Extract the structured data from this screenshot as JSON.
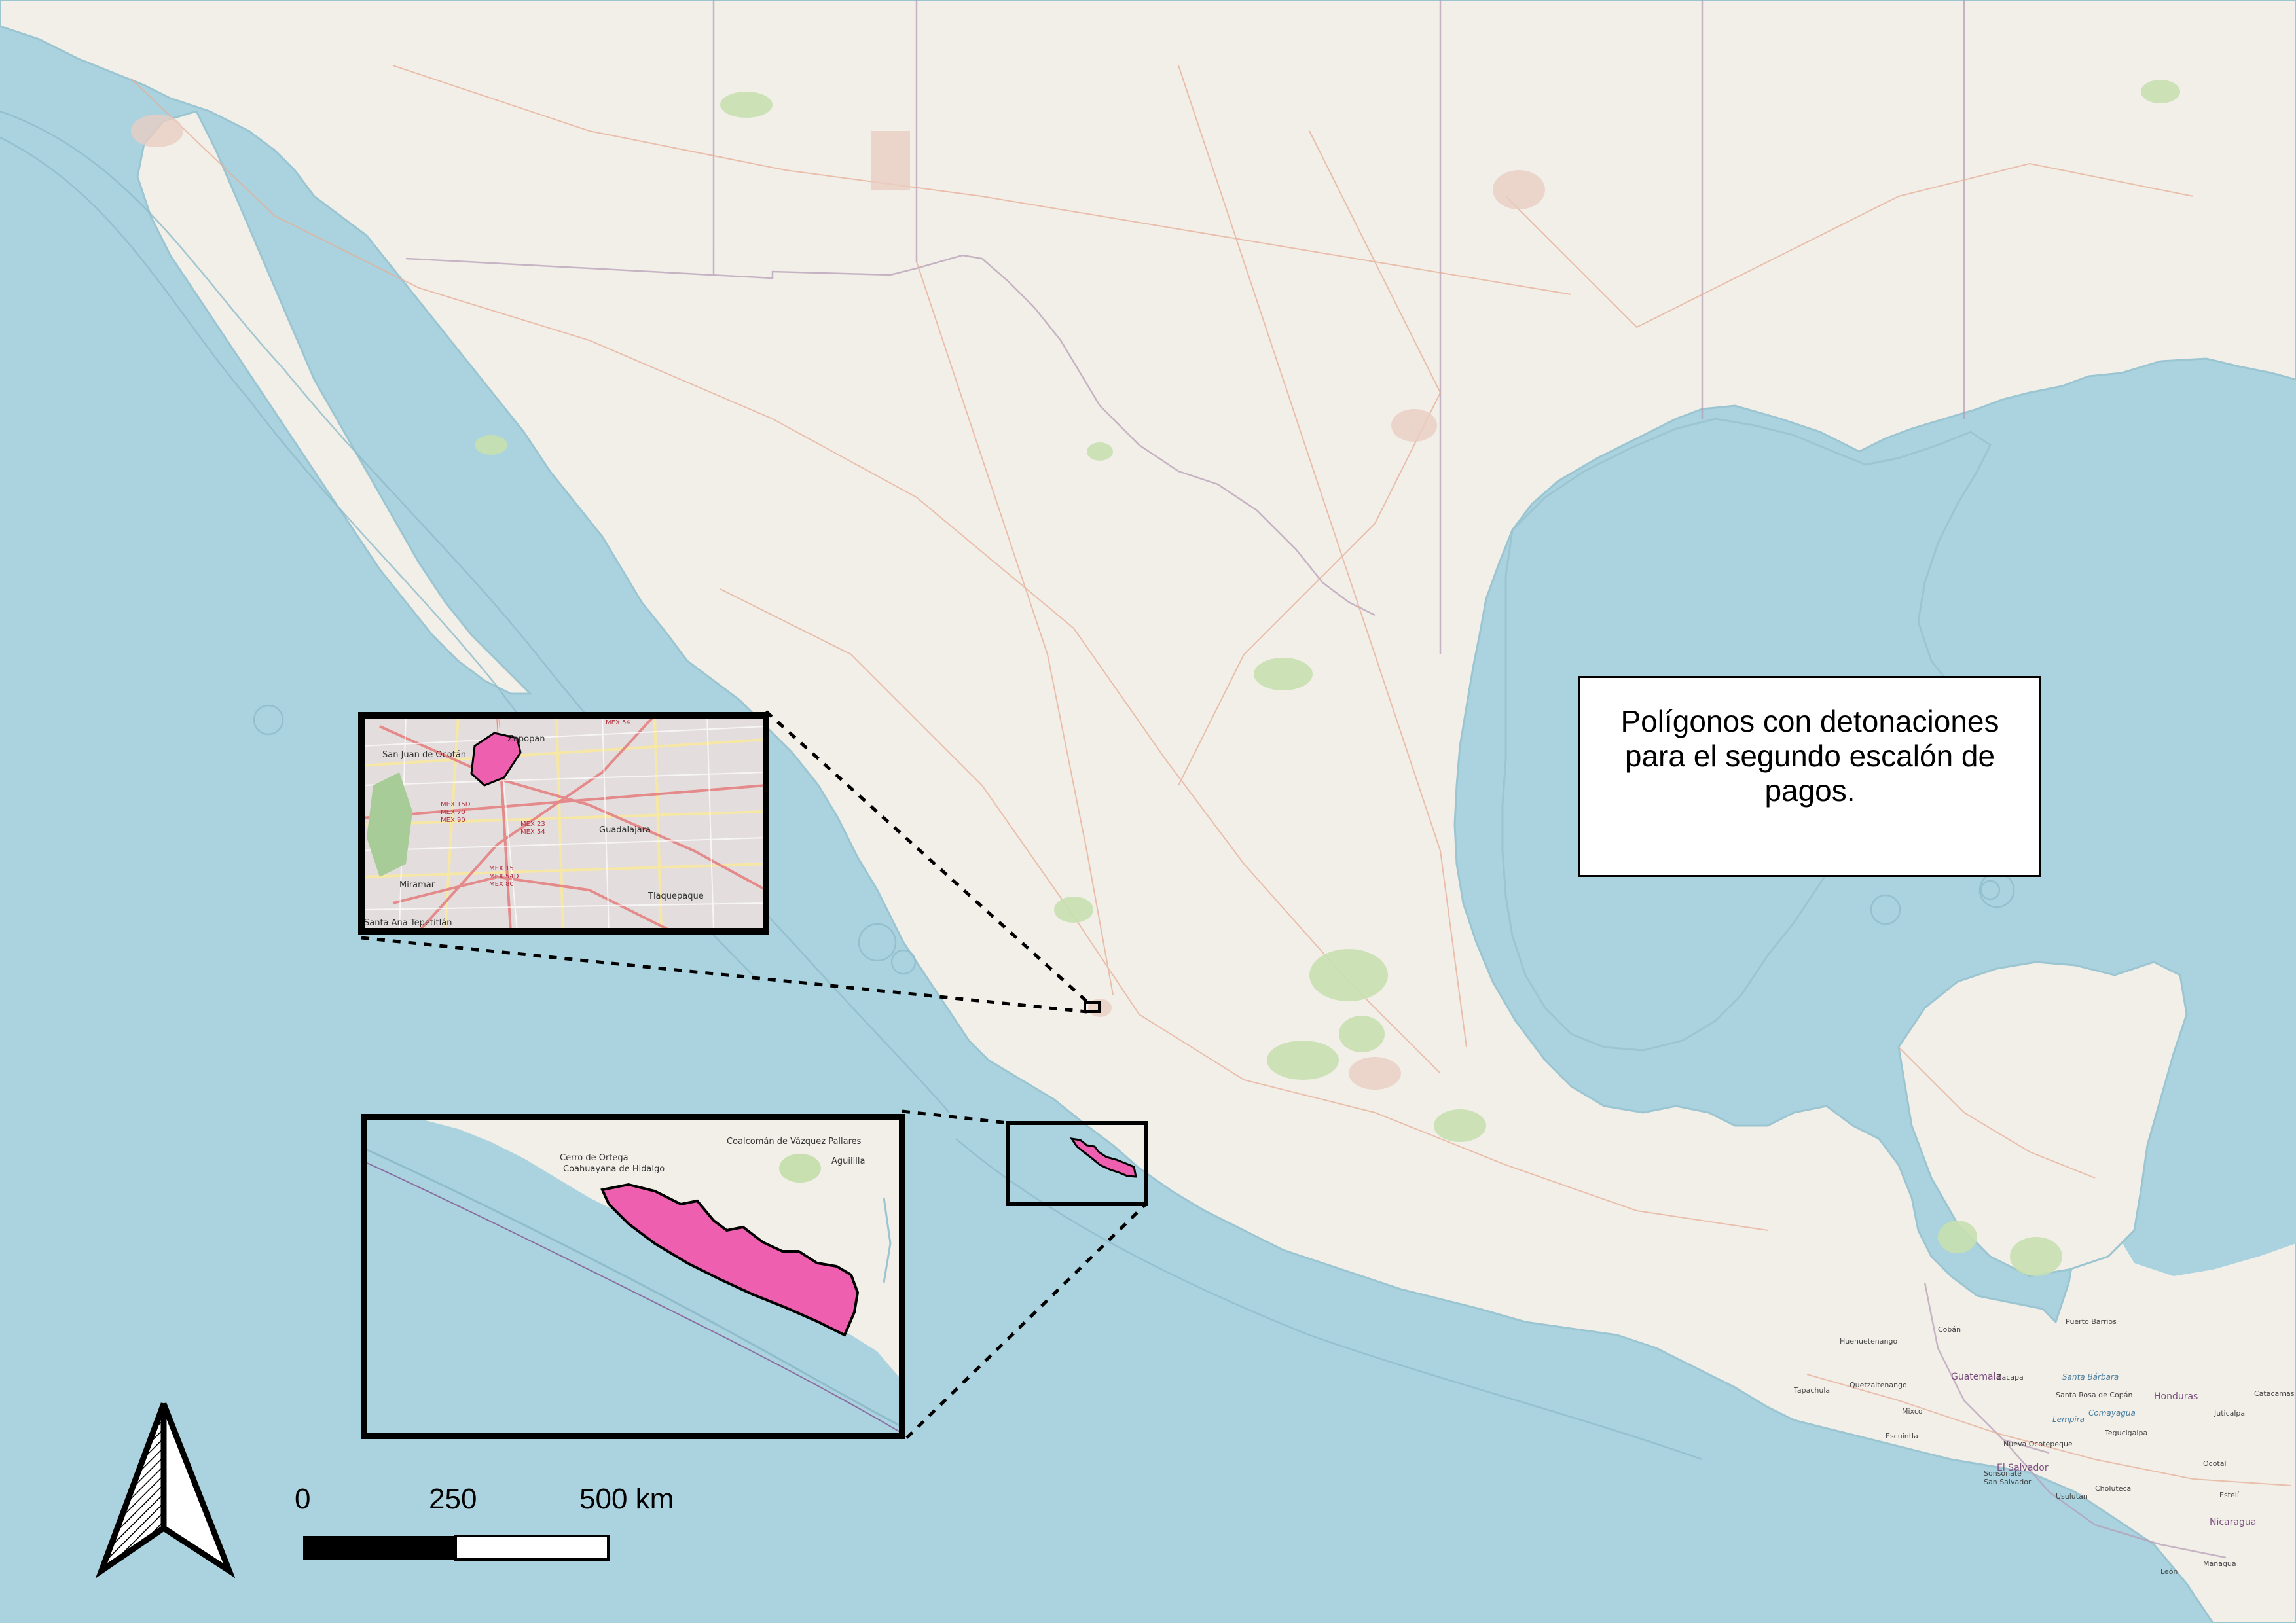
{
  "title": "Polígonos con detonaciones para el segundo escalón de pagos.",
  "scale_bar": {
    "labels": [
      "0",
      "250",
      "500 km"
    ]
  },
  "north_arrow": {
    "icon": "north-arrow-icon"
  },
  "colors": {
    "water": "#aad3df",
    "land": "#f2efe9",
    "polygon_fill": "#ee5fb0",
    "polygon_stroke": "#000000",
    "park": "#c8e0b0",
    "road": "#e8b9a0"
  },
  "inset_guadalajara": {
    "labels": [
      "Zapopan",
      "San Juan de Ocotán",
      "Guadalajara",
      "Tlaquepaque",
      "Miramar",
      "Santa Ana Tepetitlán"
    ],
    "road_labels": [
      "MEX 54",
      "MEX 15D",
      "MEX 70",
      "MEX 90",
      "MEX 23",
      "MEX 54",
      "MEX 15",
      "MEX 54D",
      "MEX 80"
    ]
  },
  "inset_coast": {
    "labels": [
      "Coalcomán de Vázquez Pallares",
      "Aguililla",
      "Cerro de Ortega",
      "Coahuayana de Hidalgo"
    ]
  },
  "map_labels": {
    "countries": [
      "Guatemala",
      "Honduras",
      "El Salvador",
      "Nicaragua"
    ],
    "cities": [
      "Huehuetenango",
      "Quetzaltenango",
      "Tapachula",
      "Escuintla",
      "Zacapa",
      "Santa Rosa de Copán",
      "Tegucigalpa",
      "Juticalpa",
      "Catacamas",
      "Puerto Barrios",
      "San Salvador",
      "Managua",
      "León",
      "Ocotal",
      "Estelí",
      "Sonsonate",
      "Usulután",
      "Choluteca",
      "Cobán",
      "Mixco",
      "Nueva Ocotepeque"
    ],
    "water": [
      "Santa Bárbara",
      "Comayagua",
      "Lempira"
    ]
  }
}
